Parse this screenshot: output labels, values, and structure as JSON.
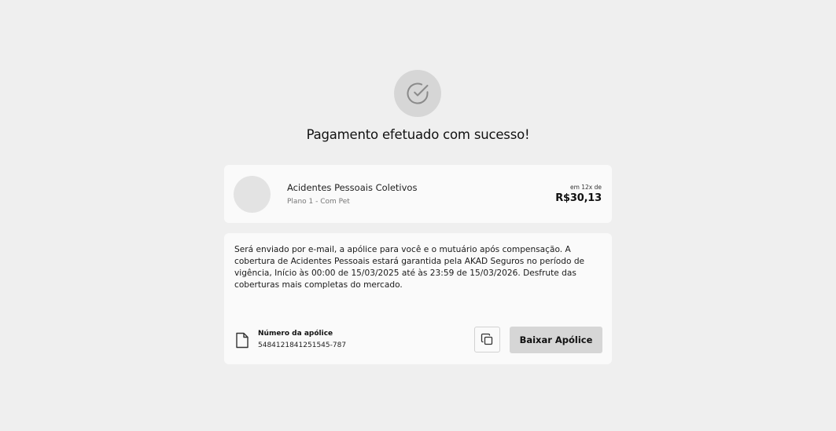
{
  "success": {
    "icon": "check-circle-icon",
    "title": "Pagamento efetuado com sucesso!"
  },
  "plan": {
    "name": "Acidentes Pessoais Coletivos",
    "subtitle": "Plano 1 - Com Pet",
    "installments_label": "em 12x de",
    "price": "R$30,13"
  },
  "info": {
    "message": "Será enviado por e-mail, a apólice para você e o mutuário após compensação. A cobertura de Acidentes Pessoais estará garantida pela AKAD Seguros no período de vigência, Início às 00:00 de 15/03/2025 até às 23:59 de 15/03/2026. Desfrute das coberturas mais completas do mercado.",
    "policy_label": "Número da apólice",
    "policy_number": "5484121841251545-787",
    "document_icon": "document-icon",
    "copy_icon": "copy-icon",
    "download_label": "Baixar Apólice"
  },
  "colors": {
    "background": "#efefef",
    "card": "#fafafa",
    "accent_gray": "#d6d6d6"
  }
}
